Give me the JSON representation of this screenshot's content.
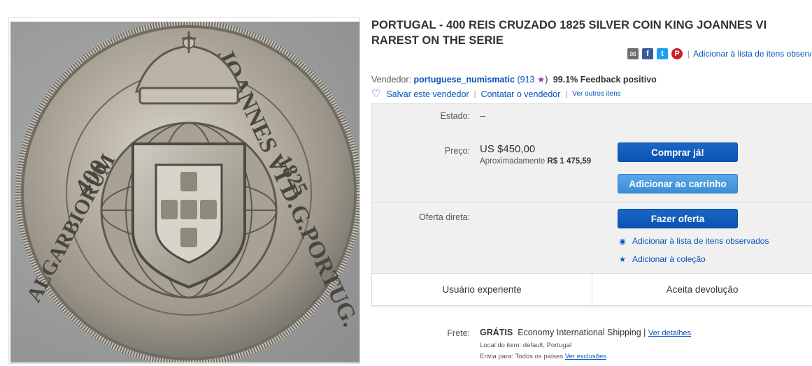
{
  "listing": {
    "title": "PORTUGAL - 400 REIS CRUZADO 1825 SILVER COIN KING JOANNES VI RAREST ON THE SERIE",
    "coin_legend_left": "ALGARBIORUM",
    "coin_legend_right": "JOANNES VI D.G.PORTUG.",
    "coin_denomination": "400",
    "coin_year": "1825"
  },
  "share": {
    "email_icon": "email-icon",
    "facebook_icon": "facebook-icon",
    "twitter_icon": "twitter-icon",
    "pinterest_icon": "pinterest-icon",
    "separator": "|",
    "watch_link": "Adicionar à lista de itens observados"
  },
  "seller": {
    "label": "Vendedor:",
    "name": "portuguese_numismatic",
    "score_open": "(913",
    "score_close": ")",
    "feedback": "99.1% Feedback positivo",
    "save_label": "Salvar este vendedor",
    "contact_label": "Contatar o vendedor",
    "other_items_label": "Ver outros itens",
    "sep": "|"
  },
  "condition": {
    "label": "Estado:",
    "value": "--"
  },
  "price": {
    "label": "Preço:",
    "value": "US $450,00",
    "approx_label": "Aproximadamente",
    "approx_value": "R$ 1 475,59"
  },
  "buttons": {
    "buy_now": "Comprar já!",
    "add_to_cart": "Adicionar ao carrinho",
    "make_offer": "Fazer oferta"
  },
  "offer": {
    "label": "Oferta direta:"
  },
  "links": {
    "add_watchlist": "Adicionar à lista de itens observados",
    "add_collection": "Adicionar à coleção"
  },
  "badges": {
    "experienced": "Usuário experiente",
    "returns": "Aceita devolução"
  },
  "shipping": {
    "label": "Frete:",
    "free": "GRÁTIS",
    "service": "Economy International Shipping |",
    "details_link": "Ver detalhes",
    "location_label": "Local do item:",
    "location_value": "default, Portugal",
    "ships_to_label": "Envia para:",
    "ships_to_value": "Todos os países",
    "exclusions_link": "Ver exclusões"
  },
  "colors": {
    "link": "#0654ba",
    "primary_button": "#0b53b0",
    "secondary_button": "#3b8fd6",
    "panel_bg": "#f0f0f0"
  }
}
